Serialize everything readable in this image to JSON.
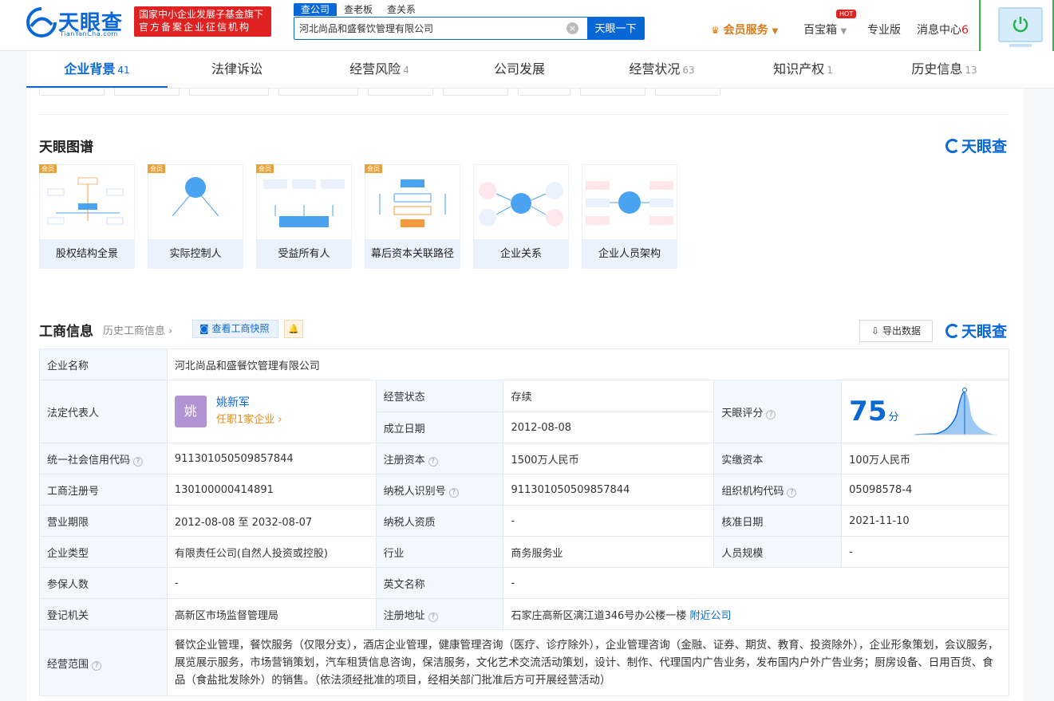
{
  "header": {
    "logo_text": "天眼查",
    "logo_sub": "TianYanCha.com",
    "badge_line1": "国家中小企业发展子基金旗下",
    "badge_line2": "官方备案企业征信机构",
    "search_tabs": [
      "查公司",
      "查老板",
      "查关系"
    ],
    "search_value": "河北尚品和盛餐饮管理有限公司",
    "search_button": "天眼一下",
    "vip": "会员服务",
    "baibao": "百宝箱",
    "hot": "HOT",
    "pro": "专业版",
    "msg": "消息中心",
    "msg_count": "6"
  },
  "tabs": [
    {
      "label": "企业背景",
      "count": "41"
    },
    {
      "label": "法律诉讼",
      "count": ""
    },
    {
      "label": "经营风险",
      "count": "4"
    },
    {
      "label": "公司发展",
      "count": ""
    },
    {
      "label": "经营状况",
      "count": "63"
    },
    {
      "label": "知识产权",
      "count": "1"
    },
    {
      "label": "历史信息",
      "count": "13"
    }
  ],
  "graph": {
    "title": "天眼图谱",
    "brand": "天眼查",
    "vip_tag": "会员",
    "cards": [
      {
        "label": "股权结构全景",
        "vip": true
      },
      {
        "label": "实际控制人",
        "vip": true
      },
      {
        "label": "受益所有人",
        "vip": true
      },
      {
        "label": "幕后资本关联路径",
        "vip": true
      },
      {
        "label": "企业关系",
        "vip": false
      },
      {
        "label": "企业人员架构",
        "vip": false
      }
    ]
  },
  "gs": {
    "title": "工商信息",
    "history": "历史工商信息",
    "snapshot": "查看工商快照",
    "export": "导出数据",
    "brand": "天眼查",
    "company_name_key": "企业名称",
    "company_name": "河北尚品和盛餐饮管理有限公司",
    "rep_key": "法定代表人",
    "rep_avatar": "姚",
    "rep_name": "姚新军",
    "rep_sub": "任职1家企业",
    "status_key": "经营状态",
    "status": "存续",
    "founded_key": "成立日期",
    "founded": "2012-08-08",
    "score_key": "天眼评分",
    "score": "75",
    "score_unit": "分",
    "rows": [
      [
        "统一社会信用代码",
        "911301050509857844",
        "注册资本",
        "1500万人民币",
        "实缴资本",
        "100万人民币"
      ],
      [
        "工商注册号",
        "130100000414891",
        "纳税人识别号",
        "911301050509857844",
        "组织机构代码",
        "05098578-4"
      ],
      [
        "营业期限",
        "2012-08-08 至 2032-08-07",
        "纳税人资质",
        "-",
        "核准日期",
        "2021-11-10"
      ],
      [
        "企业类型",
        "有限责任公司(自然人投资或控股)",
        "行业",
        "商务服务业",
        "人员规模",
        "-"
      ]
    ],
    "insured_key": "参保人数",
    "insured": "-",
    "english_key": "英文名称",
    "english": "-",
    "authority_key": "登记机关",
    "authority": "高新区市场监督管理局",
    "address_key": "注册地址",
    "address": "石家庄高新区漓江道346号办公楼一楼",
    "nearby": "附近公司",
    "scope_key": "经营范围",
    "scope": "餐饮企业管理，餐饮服务（仅限分支），酒店企业管理，健康管理咨询（医疗、诊疗除外），企业管理咨询（金融、证券、期货、教育、投资除外），企业形象策划，会议服务，展览展示服务，市场营销策划，汽车租赁信息咨询，保洁服务，文化艺术交流活动策划，设计、制作、代理国内广告业务，发布国内户外广告业务；厨房设备、日用百货、食品（食盐批发除外）的销售。（依法须经批准的项目，经相关部门批准后方可开展经营活动）"
  }
}
